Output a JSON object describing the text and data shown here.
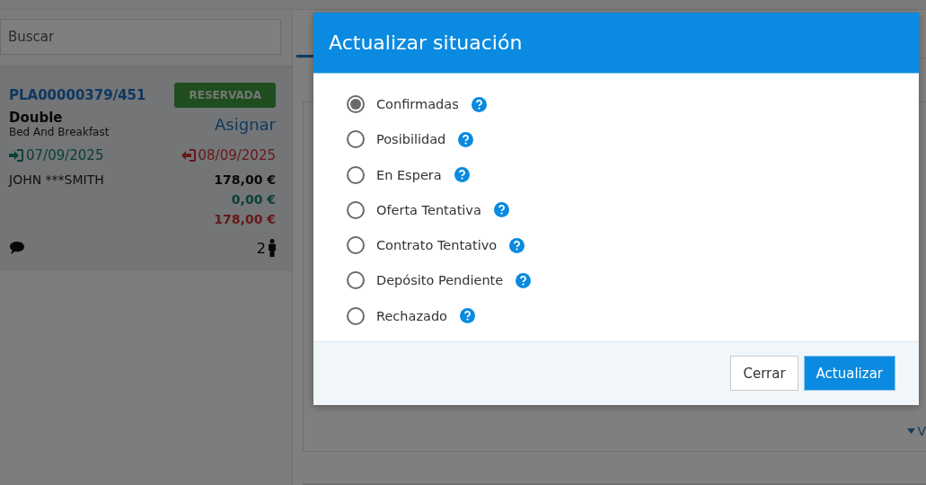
{
  "search": {
    "placeholder": "Buscar"
  },
  "booking_card": {
    "code": "PLA00000379/451",
    "status": "RESERVADA",
    "room_type": "Double",
    "board": "Bed And Breakfast",
    "assign_link": "Asignar",
    "check_in": "07/09/2025",
    "check_out": "08/09/2025",
    "guest": "JOHN ***SMITH",
    "total": "178,00 €",
    "paid": "0,00 €",
    "pending": "178,00 €",
    "guests": "2"
  },
  "background_link": "V",
  "dialog": {
    "title": "Actualizar situación",
    "options": [
      {
        "label": "Confirmadas",
        "selected": true
      },
      {
        "label": "Posibilidad",
        "selected": false
      },
      {
        "label": "En Espera",
        "selected": false
      },
      {
        "label": "Oferta Tentativa",
        "selected": false
      },
      {
        "label": "Contrato Tentativo",
        "selected": false
      },
      {
        "label": "Depósito Pendiente",
        "selected": false
      },
      {
        "label": "Rechazado",
        "selected": false
      }
    ],
    "buttons": [
      {
        "label": "Cerrar",
        "kind": "default"
      },
      {
        "label": "Actualizar",
        "kind": "primary"
      }
    ]
  }
}
